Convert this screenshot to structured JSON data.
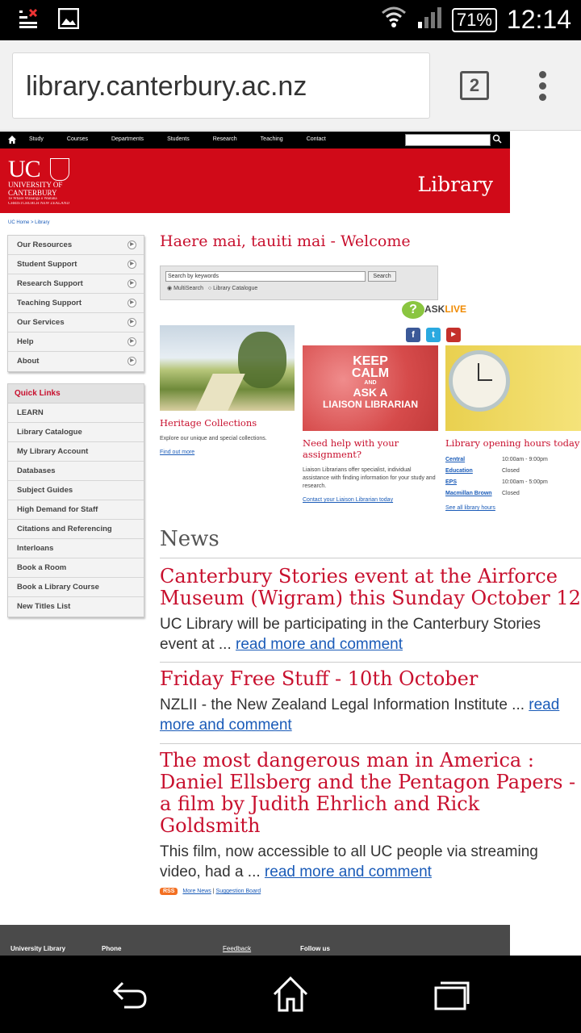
{
  "status_bar": {
    "battery": "71%",
    "time": "12:14"
  },
  "browser": {
    "url": "library.canterbury.ac.nz",
    "tab_count": "2"
  },
  "topnav": {
    "items": [
      "Study",
      "Courses",
      "Departments",
      "Students",
      "Research",
      "Teaching",
      "Contact"
    ]
  },
  "banner": {
    "logo_uc": "UC",
    "logo_line1": "UNIVERSITY OF",
    "logo_line2": "CANTERBURY",
    "logo_tag1": "Te Whare Wānanga o Waitaha",
    "logo_tag2": "CHRISTCHURCH NEW ZEALAND",
    "title": "Library"
  },
  "breadcrumb": "UC Home > Library",
  "sidebar": {
    "items": [
      "Our Resources",
      "Student Support",
      "Research Support",
      "Teaching Support",
      "Our Services",
      "Help",
      "About"
    ]
  },
  "quick_links": {
    "heading": "Quick Links",
    "items": [
      "LEARN",
      "Library Catalogue",
      "My Library Account",
      "Databases",
      "Subject Guides",
      "High Demand for Staff",
      "Citations and Referencing",
      "Interloans",
      "Book a Room",
      "Book a Library Course",
      "New Titles List"
    ]
  },
  "main": {
    "welcome": "Haere mai, tauiti mai - Welcome",
    "search": {
      "placeholder": "Search by keywords",
      "button": "Search",
      "opt1": "MultiSearch",
      "opt2": "Library Catalogue"
    },
    "asklive": {
      "ask": "ASK",
      "live": "LIVE"
    }
  },
  "heritage": {
    "title": "Heritage Collections",
    "text": "Explore our unique and special collections.",
    "link": "Find out more"
  },
  "liaison": {
    "image_l1": "KEEP",
    "image_l2": "CALM",
    "image_l3": "AND",
    "image_l4": "ASK A",
    "image_l5": "LIAISON LIBRARIAN",
    "title": "Need help with your assignment?",
    "text": "Liaison Librarians offer specialist, individual assistance with finding information for your study and research.",
    "link": "Contact your Liaison Librarian today"
  },
  "hours": {
    "title": "Library opening hours today",
    "rows": [
      {
        "lib": "Central",
        "time": "10:00am - 9:00pm"
      },
      {
        "lib": "Education",
        "time": "Closed"
      },
      {
        "lib": "EPS",
        "time": "10:00am - 5:00pm"
      },
      {
        "lib": "Macmillan Brown",
        "time": "Closed"
      }
    ],
    "link": "See all library hours"
  },
  "news": {
    "title": "News",
    "stories": [
      {
        "headline": "Canterbury Stories event at the Airforce Museum (Wigram) this Sunday October 12",
        "body": "UC Library will be participating in the Canterbury Stories event at ... ",
        "link": "read more and comment"
      },
      {
        "headline": "Friday Free Stuff - 10th October",
        "body": "NZLII - the New Zealand Legal Information Institute ... ",
        "link": "read more and comment"
      },
      {
        "headline": "The most dangerous man in America : Daniel Ellsberg and the Pentagon Papers - a film by Judith Ehrlich and Rick Goldsmith",
        "body": "This film, now accessible to all UC people via streaming video, had a ... ",
        "link": "read more and comment"
      }
    ],
    "rss": "RSS",
    "more": "More News",
    "sep": " | ",
    "suggest": "Suggestion Board"
  },
  "footer": {
    "col1": "University Library",
    "col2": "Phone",
    "col3": "Feedback",
    "col4": "Follow us"
  }
}
